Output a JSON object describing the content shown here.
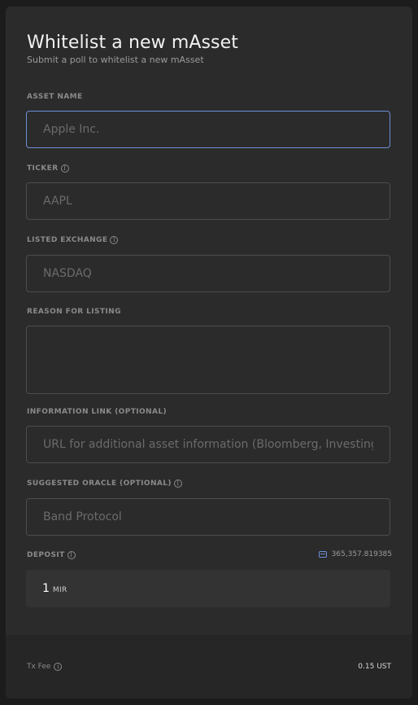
{
  "header": {
    "title": "Whitelist a new mAsset",
    "subtitle": "Submit a poll to whitelist a new mAsset"
  },
  "fields": {
    "asset_name": {
      "label": "ASSET NAME",
      "placeholder": "Apple Inc.",
      "value": ""
    },
    "ticker": {
      "label": "TICKER",
      "placeholder": "AAPL",
      "value": ""
    },
    "listed_exchange": {
      "label": "LISTED EXCHANGE",
      "placeholder": "NASDAQ",
      "value": ""
    },
    "reason": {
      "label": "REASON FOR LISTING",
      "placeholder": "",
      "value": ""
    },
    "information_link": {
      "label": "INFORMATION LINK (OPTIONAL)",
      "placeholder": "URL for additional asset information (Bloomberg, Investing.com, etc.)",
      "value": ""
    },
    "suggested_oracle": {
      "label": "SUGGESTED ORACLE (OPTIONAL)",
      "placeholder": "Band Protocol",
      "value": ""
    }
  },
  "deposit": {
    "label": "DEPOSIT",
    "balance": "365,357.819385",
    "amount": "1",
    "unit": "MIR"
  },
  "footer": {
    "tx_fee_label": "Tx Fee",
    "tx_fee_value": "0.15 UST"
  },
  "icons": {
    "info": "info-circle-icon",
    "wallet": "wallet-icon"
  },
  "colors": {
    "focus_border": "#6b8fd6",
    "card_bg": "#2b2b2b",
    "page_bg": "#1c1c1c"
  }
}
